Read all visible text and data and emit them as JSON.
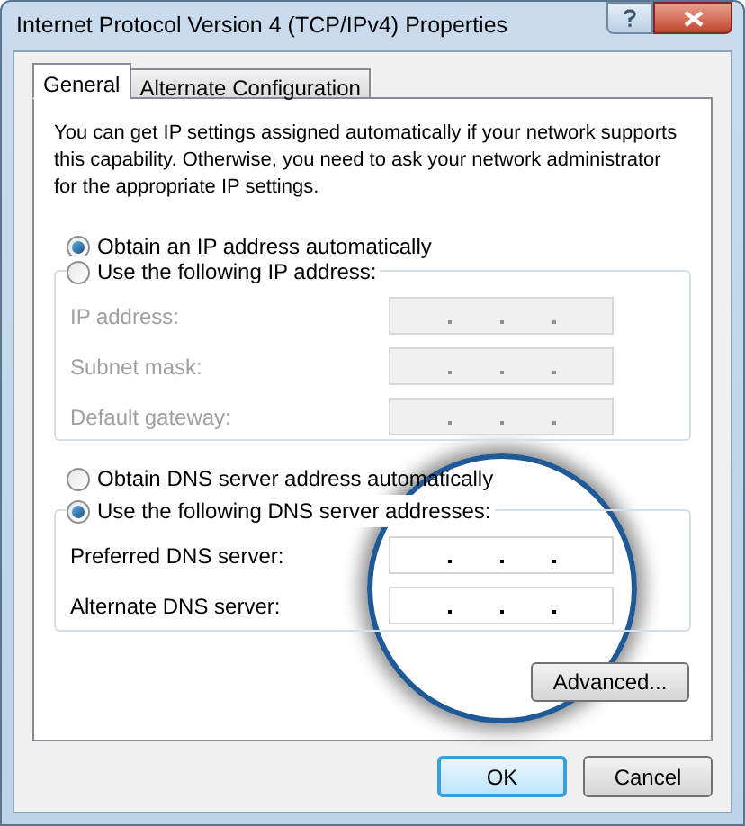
{
  "window": {
    "title": "Internet Protocol Version 4 (TCP/IPv4) Properties"
  },
  "tabs": [
    {
      "label": "General",
      "selected": true
    },
    {
      "label": "Alternate Configuration",
      "selected": false
    }
  ],
  "description": "You can get IP settings assigned automatically if your network supports this capability. Otherwise, you need to ask your network administrator for the appropriate IP settings.",
  "ip_mode": [
    {
      "label": "Obtain an IP address automatically",
      "selected": true
    },
    {
      "label": "Use the following IP address:",
      "selected": false
    }
  ],
  "ip_fields": [
    {
      "label": "IP address:",
      "disabled": true
    },
    {
      "label": "Subnet mask:",
      "disabled": true
    },
    {
      "label": "Default gateway:",
      "disabled": true
    }
  ],
  "dns_mode": [
    {
      "label": "Obtain DNS server address automatically",
      "selected": false
    },
    {
      "label": "Use the following DNS server addresses:",
      "selected": true
    }
  ],
  "dns_fields": [
    {
      "label": "Preferred DNS server:",
      "disabled": false
    },
    {
      "label": "Alternate DNS server:",
      "disabled": false
    }
  ],
  "advanced_button": "Advanced...",
  "buttons": [
    {
      "label": "OK",
      "default": true
    },
    {
      "label": "Cancel",
      "default": false
    }
  ]
}
